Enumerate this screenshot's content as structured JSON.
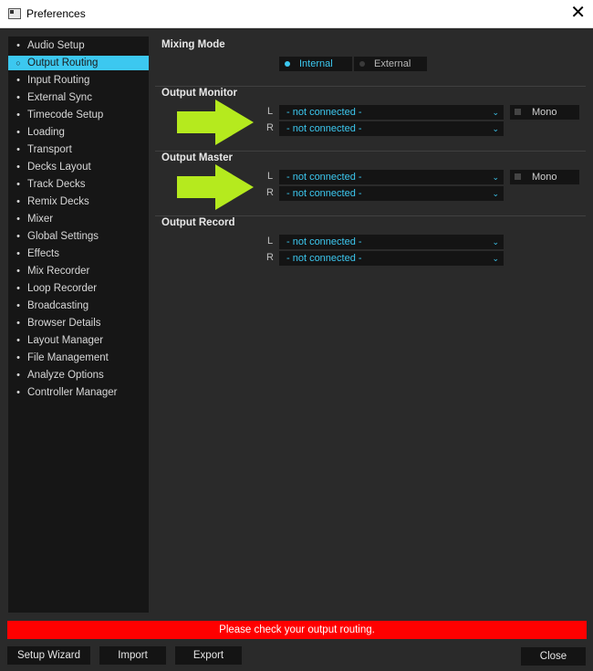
{
  "window": {
    "title": "Preferences"
  },
  "sidebar": {
    "items": [
      {
        "label": "Audio Setup"
      },
      {
        "label": "Output Routing",
        "active": true
      },
      {
        "label": "Input Routing"
      },
      {
        "label": "External Sync"
      },
      {
        "label": "Timecode Setup"
      },
      {
        "label": "Loading"
      },
      {
        "label": "Transport"
      },
      {
        "label": "Decks Layout"
      },
      {
        "label": "Track Decks"
      },
      {
        "label": "Remix Decks"
      },
      {
        "label": "Mixer"
      },
      {
        "label": "Global Settings"
      },
      {
        "label": "Effects"
      },
      {
        "label": "Mix Recorder"
      },
      {
        "label": "Loop Recorder"
      },
      {
        "label": "Broadcasting"
      },
      {
        "label": "Browser Details"
      },
      {
        "label": "Layout Manager"
      },
      {
        "label": "File Management"
      },
      {
        "label": "Analyze Options"
      },
      {
        "label": "Controller Manager"
      }
    ]
  },
  "mixing_mode": {
    "title": "Mixing Mode",
    "options": [
      "Internal",
      "External"
    ],
    "selected": "Internal"
  },
  "output_monitor": {
    "title": "Output Monitor",
    "left_label": "L",
    "right_label": "R",
    "left_value": "- not connected -",
    "right_value": "- not connected -",
    "mono_label": "Mono"
  },
  "output_master": {
    "title": "Output Master",
    "left_label": "L",
    "right_label": "R",
    "left_value": "- not connected -",
    "right_value": "- not connected -",
    "mono_label": "Mono"
  },
  "output_record": {
    "title": "Output Record",
    "left_label": "L",
    "right_label": "R",
    "left_value": "- not connected -",
    "right_value": "- not connected -"
  },
  "warning": "Please check your output routing.",
  "footer": {
    "setup_wizard": "Setup Wizard",
    "import": "Import",
    "export": "Export",
    "close": "Close"
  },
  "colors": {
    "accent": "#3cc8f0",
    "warning": "#ff0000",
    "arrow": "#b5ea1e"
  }
}
